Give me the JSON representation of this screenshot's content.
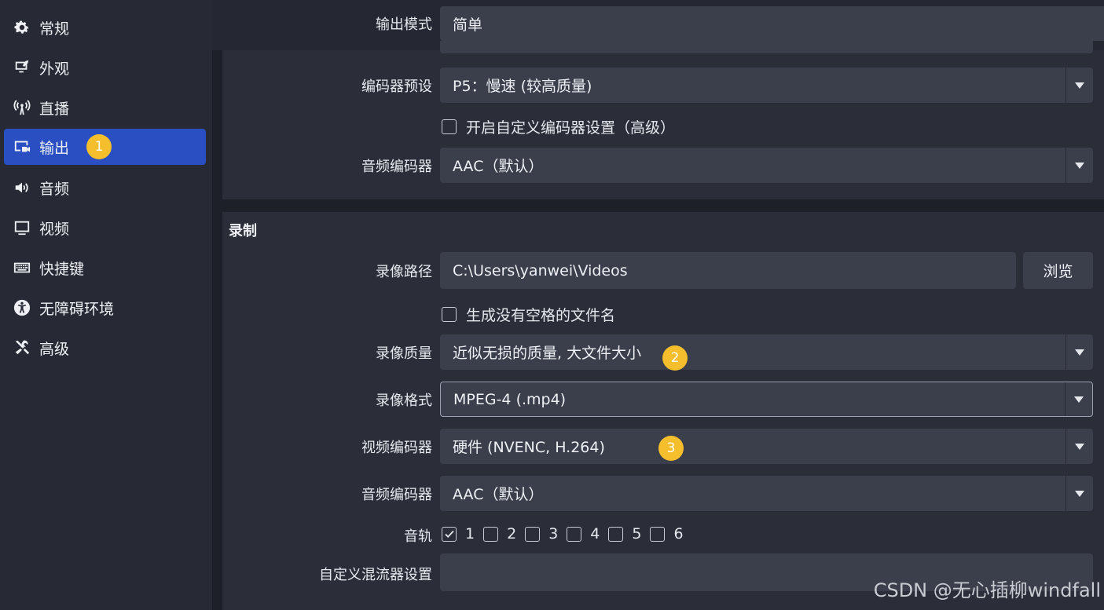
{
  "sidebar": {
    "items": [
      {
        "label": "常规",
        "icon": "gear-icon"
      },
      {
        "label": "外观",
        "icon": "appearance-icon"
      },
      {
        "label": "直播",
        "icon": "broadcast-icon"
      },
      {
        "label": "输出",
        "icon": "output-icon",
        "active": true
      },
      {
        "label": "音频",
        "icon": "speaker-icon"
      },
      {
        "label": "视频",
        "icon": "monitor-icon"
      },
      {
        "label": "快捷键",
        "icon": "keyboard-icon"
      },
      {
        "label": "无障碍环境",
        "icon": "accessibility-icon"
      },
      {
        "label": "高级",
        "icon": "tools-icon"
      }
    ]
  },
  "badges": {
    "b1": "1",
    "b2": "2",
    "b3": "3"
  },
  "top": {
    "output_mode_label": "输出模式",
    "output_mode_value": "简单",
    "encoder_preset_label": "编码器预设",
    "encoder_preset_value": "P5：慢速 (较高质量)",
    "custom_encoder_label": "开启自定义编码器设置（高级）",
    "audio_encoder_label": "音频编码器",
    "audio_encoder_value": "AAC（默认）"
  },
  "recording": {
    "title": "录制",
    "path_label": "录像路径",
    "path_value": "C:\\Users\\yanwei\\Videos",
    "browse_label": "浏览",
    "no_space_label": "生成没有空格的文件名",
    "quality_label": "录像质量",
    "quality_value": "近似无损的质量, 大文件大小",
    "format_label": "录像格式",
    "format_value": "MPEG-4 (.mp4)",
    "video_encoder_label": "视频编码器",
    "video_encoder_value": "硬件 (NVENC, H.264)",
    "audio_encoder_label": "音频编码器",
    "audio_encoder_value": "AAC（默认）",
    "tracks_label": "音轨",
    "tracks": [
      {
        "label": "1",
        "checked": true
      },
      {
        "label": "2",
        "checked": false
      },
      {
        "label": "3",
        "checked": false
      },
      {
        "label": "4",
        "checked": false
      },
      {
        "label": "5",
        "checked": false
      },
      {
        "label": "6",
        "checked": false
      }
    ],
    "muxer_label": "自定义混流器设置",
    "muxer_value": ""
  },
  "watermark": "CSDN @无心插柳windfall",
  "colors": {
    "accent": "#2a4fc2",
    "badge": "#f4be2c",
    "background": "#1e2029",
    "panel": "#2b2e39",
    "field": "#3b3e4b"
  }
}
